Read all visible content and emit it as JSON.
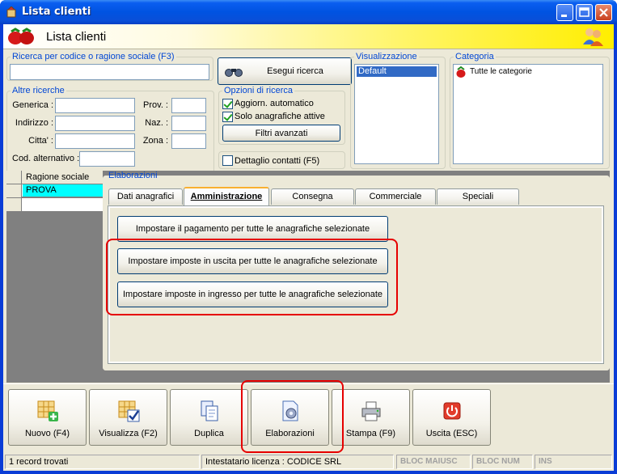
{
  "window": {
    "title": "Lista clienti"
  },
  "header": {
    "title": "Lista clienti"
  },
  "search": {
    "legend": "Ricerca per codice o ragione sociale (F3)",
    "value": "",
    "button": "Esegui ricerca"
  },
  "other_search": {
    "legend": "Altre ricerche",
    "fields": {
      "generica": "Generica :",
      "indirizzo": "Indirizzo :",
      "citta": "Citta' :",
      "prov": "Prov. :",
      "naz": "Naz. :",
      "zona": "Zona :",
      "cod_alt": "Cod. alternativo :"
    }
  },
  "options": {
    "legend": "Opzioni di ricerca",
    "auto_update": "Aggiorn. automatico",
    "only_active": "Solo anagrafiche attive",
    "advanced": "Filtri avanzati",
    "contact_detail": "Dettaglio contatti (F5)"
  },
  "view": {
    "legend": "Visualizzazione",
    "selected": "Default"
  },
  "category": {
    "legend": "Categoria",
    "item": "Tutte le categorie"
  },
  "grid": {
    "column": "Ragione sociale",
    "rows": [
      "PROVA",
      ""
    ]
  },
  "processing": {
    "legend": "Elaborazioni",
    "tabs": [
      "Dati anagrafici",
      "Amministrazione",
      "Consegna",
      "Commerciale",
      "Speciali"
    ],
    "active_tab": "Amministrazione",
    "actions": [
      "Impostare il pagamento per tutte le anagrafiche selezionate",
      "Impostare imposte in uscita per tutte le anagrafiche selezionate",
      "Impostare imposte in ingresso per tutte le anagrafiche selezionate"
    ]
  },
  "toolbar": {
    "new": "Nuovo (F4)",
    "view": "Visualizza (F2)",
    "duplicate": "Duplica",
    "process": "Elaborazioni",
    "print": "Stampa (F9)",
    "exit": "Uscita (ESC)"
  },
  "icons": [
    "app-icon",
    "minimize-icon",
    "maximize-icon",
    "close-icon",
    "strawberries-icon",
    "users-icon",
    "binoculars-icon",
    "strawberry-icon",
    "grid-add-icon",
    "grid-check-icon",
    "duplicate-icon",
    "process-icon",
    "printer-icon",
    "exit-icon"
  ],
  "statusbar": {
    "records": "1 record trovati",
    "license": "Intestatario licenza : CODICE SRL",
    "caps": "BLOC MAIUSC",
    "num": "BLOC NUM",
    "ins": "INS"
  },
  "colors": {
    "title_bar": "#0053e1",
    "highlight": "#e60000",
    "selection": "#316ac5",
    "row_selected": "#00ffff",
    "header_yellow": "#ffee00"
  }
}
